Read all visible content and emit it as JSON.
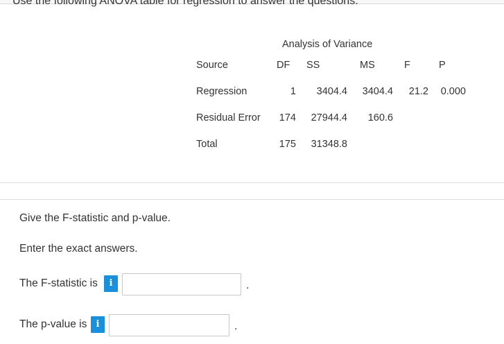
{
  "instructions": "Use the following ANOVA table for regression to answer the questions.",
  "anova": {
    "title": "Analysis of Variance",
    "headers": {
      "source": "Source",
      "df": "DF",
      "ss": "SS",
      "ms": "MS",
      "f": "F",
      "p": "P"
    },
    "rows": [
      {
        "source": "Regression",
        "df": "1",
        "ss": "3404.4",
        "ms": "3404.4",
        "f": "21.2",
        "p": "0.000"
      },
      {
        "source": "Residual Error",
        "df": "174",
        "ss": "27944.4",
        "ms": "160.6",
        "f": "",
        "p": ""
      },
      {
        "source": "Total",
        "df": "175",
        "ss": "31348.8",
        "ms": "",
        "f": "",
        "p": ""
      }
    ]
  },
  "question": {
    "prompt": "Give the F-statistic and p-value.",
    "instruction": "Enter the exact answers.",
    "f_label": "The F-statistic is",
    "p_label": "The p-value is",
    "period": "."
  },
  "info_glyph": "i",
  "icons": {
    "info": "info-icon"
  },
  "colors": {
    "info_button": "#1a8fdc",
    "text": "#333333",
    "border": "#c8c8c8"
  },
  "inputs": {
    "f_value": "",
    "p_value": ""
  }
}
